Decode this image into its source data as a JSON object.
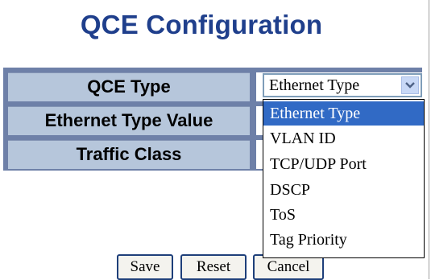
{
  "page": {
    "title": "QCE Configuration"
  },
  "rows": [
    {
      "label": "QCE Type"
    },
    {
      "label": "Ethernet Type Value"
    },
    {
      "label": "Traffic Class"
    }
  ],
  "select": {
    "value": "Ethernet Type",
    "options": [
      "Ethernet Type",
      "VLAN ID",
      "TCP/UDP Port",
      "DSCP",
      "ToS",
      "Tag Priority"
    ],
    "selected_option": "Ethernet Type"
  },
  "buttons": {
    "save": "Save",
    "reset": "Reset",
    "cancel": "Cancel"
  },
  "colors": {
    "title": "#1f3f8c",
    "label_bg": "#b6c6db",
    "table_border": "#6e80a8",
    "highlight": "#316ac5"
  }
}
